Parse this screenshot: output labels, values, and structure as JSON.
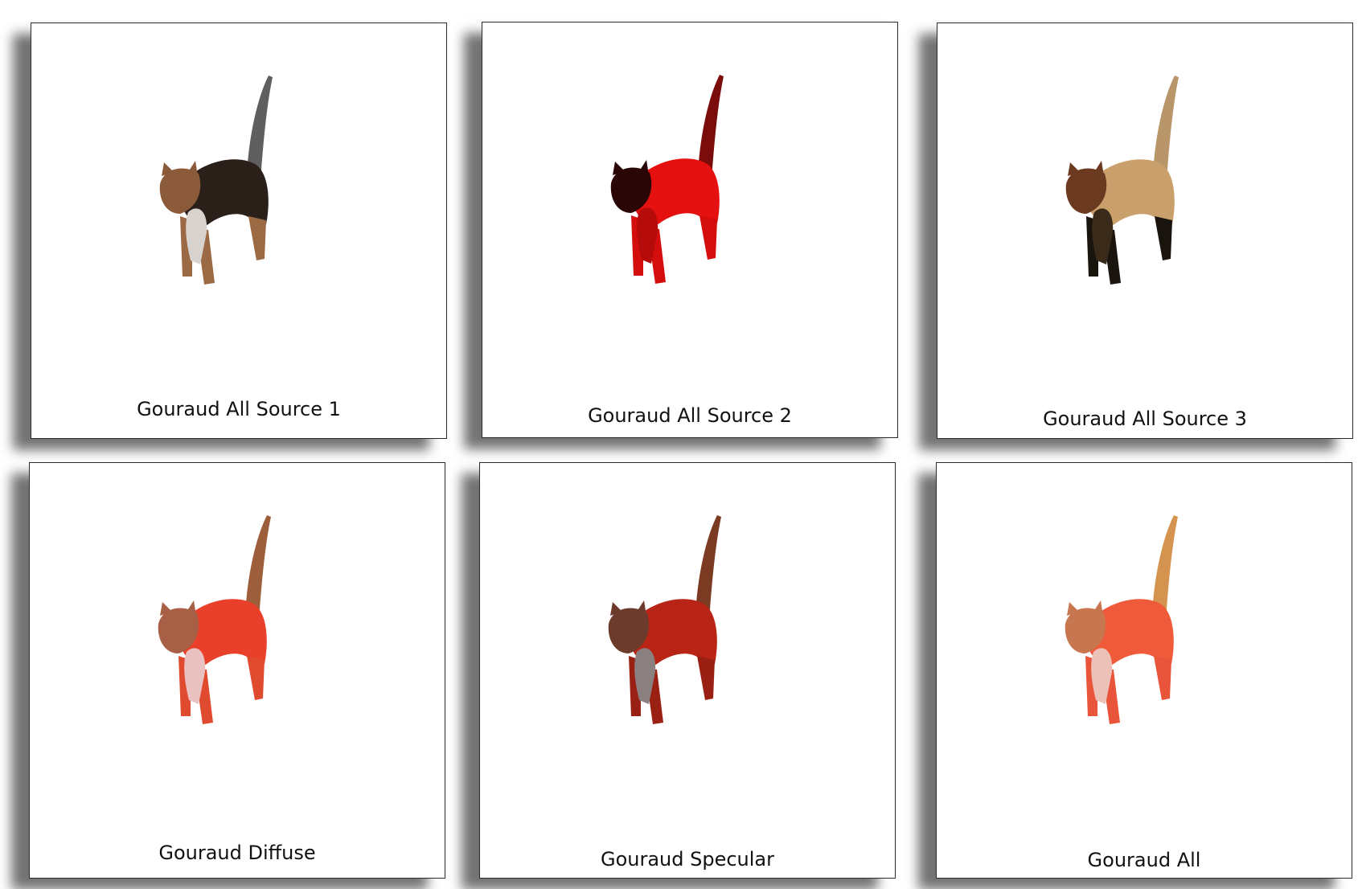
{
  "panels": [
    {
      "caption": "Gouraud All Source 1",
      "body": "#2b1f1a",
      "chest": "#d8d3cf",
      "head": "#8a5a3a",
      "tail": "#5f5f5f",
      "legs": "#9b6a45"
    },
    {
      "caption": "Gouraud All Source 2",
      "body": "#e51010",
      "chest": "#b50b0b",
      "head": "#2a0606",
      "tail": "#7a0c0c",
      "legs": "#d40d0d"
    },
    {
      "caption": "Gouraud All Source 3",
      "body": "#c9a06b",
      "chest": "#3a2a1a",
      "head": "#6b3a20",
      "tail": "#b9956a",
      "legs": "#1a140f"
    },
    {
      "caption": "Gouraud Diffuse",
      "body": "#e8402a",
      "chest": "#e9c1c1",
      "head": "#a76045",
      "tail": "#9d5e3b",
      "legs": "#e04b30"
    },
    {
      "caption": "Gouraud Specular",
      "body": "#b82516",
      "chest": "#8a8080",
      "head": "#6d3b2b",
      "tail": "#7b3a22",
      "legs": "#9a2014"
    },
    {
      "caption": "Gouraud All",
      "body": "#ef5a3a",
      "chest": "#ebc1b8",
      "head": "#c7774f",
      "tail": "#d4944f",
      "legs": "#e9553a"
    }
  ]
}
